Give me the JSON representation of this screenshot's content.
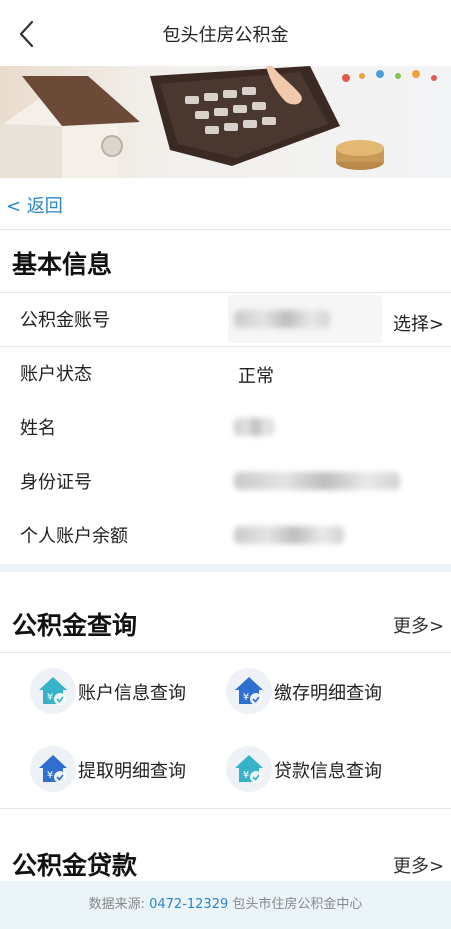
{
  "nav": {
    "title": "包头住房公积金"
  },
  "return_link": "< 返回",
  "basic_info": {
    "title": "基本信息",
    "choose_label": "选择>",
    "rows": [
      {
        "label": "公积金账号",
        "value": ""
      },
      {
        "label": "账户状态",
        "value": "正常"
      },
      {
        "label": "姓名",
        "value": ""
      },
      {
        "label": "身份证号",
        "value": ""
      },
      {
        "label": "个人账户余额",
        "value": ""
      }
    ]
  },
  "query": {
    "title": "公积金查询",
    "more": "更多>",
    "items": [
      {
        "label": "账户信息查询",
        "icon": "house-yuan-icon"
      },
      {
        "label": "缴存明细查询",
        "icon": "house-yuan-icon"
      },
      {
        "label": "提取明细查询",
        "icon": "house-yuan-icon"
      },
      {
        "label": "贷款信息查询",
        "icon": "house-yuan-icon"
      }
    ]
  },
  "loan": {
    "title": "公积金贷款",
    "more": "更多>"
  },
  "footer": {
    "prefix": "数据来源:",
    "phone": "0472-12329",
    "org": "包头市住房公积金中心"
  },
  "colors": {
    "link": "#2a86c8",
    "icon_blue": "#2f6fd0",
    "icon_teal": "#36b3c8",
    "band": "#e8f2f8"
  }
}
